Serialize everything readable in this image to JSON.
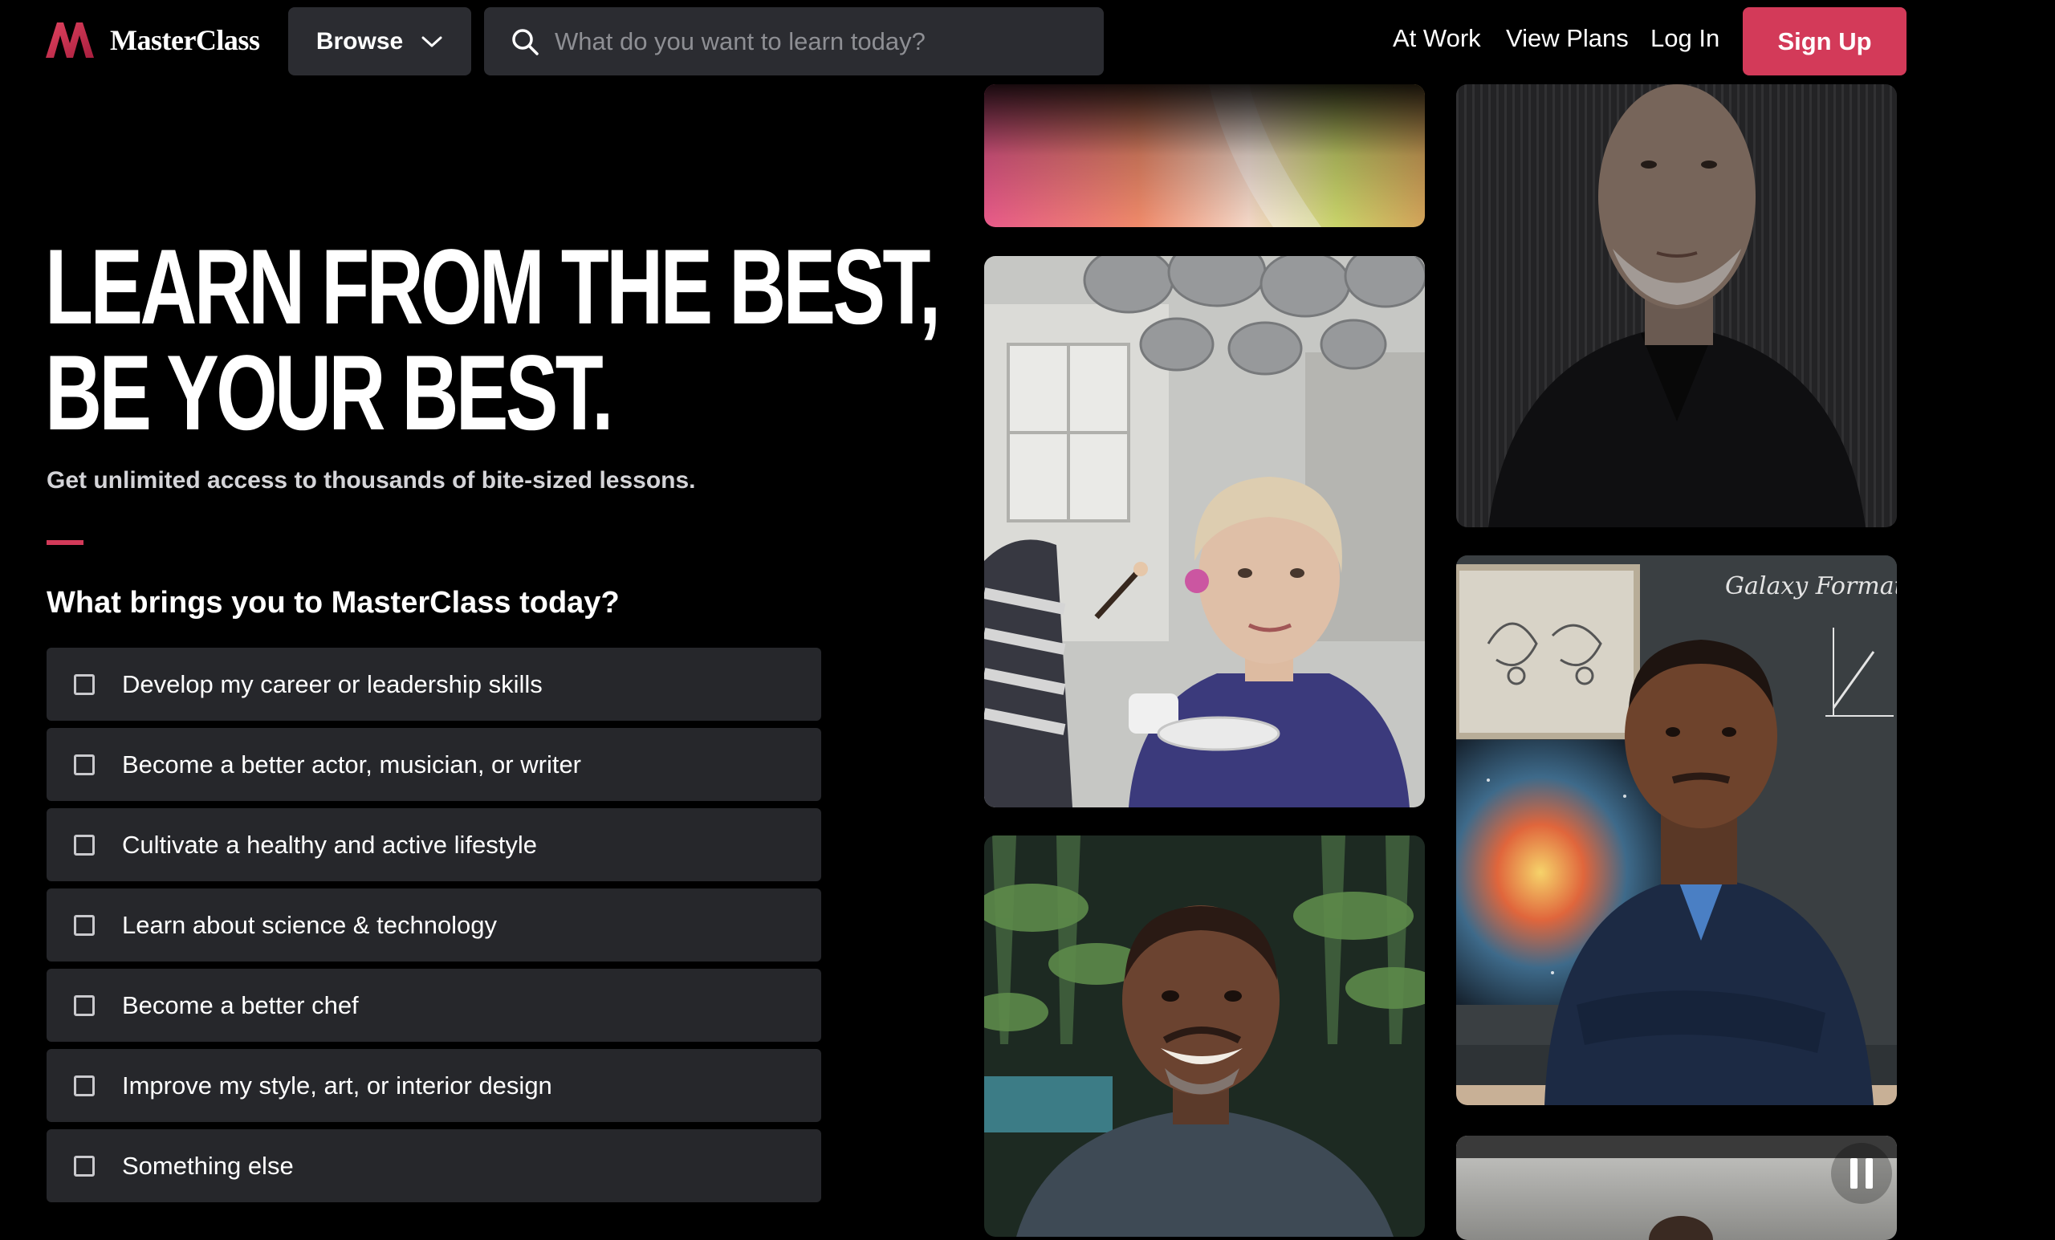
{
  "brand": {
    "name": "MasterClass",
    "accent": "#d33a59"
  },
  "header": {
    "browse_label": "Browse",
    "search_placeholder": "What do you want to learn today?",
    "links": {
      "at_work": "At Work",
      "view_plans": "View Plans",
      "log_in": "Log In"
    },
    "signup_label": "Sign Up"
  },
  "hero": {
    "headline_line1": "LEARN FROM THE BEST,",
    "headline_line2": "BE YOUR BEST.",
    "subheadline": "Get unlimited access to thousands of bite-sized lessons.",
    "question": "What brings you to MasterClass today?",
    "options": [
      {
        "label": "Develop my career or leadership skills",
        "checked": false
      },
      {
        "label": "Become a better actor, musician, or writer",
        "checked": false
      },
      {
        "label": "Cultivate a healthy and active lifestyle",
        "checked": false
      },
      {
        "label": "Learn about science & technology",
        "checked": false
      },
      {
        "label": "Become a better chef",
        "checked": false
      },
      {
        "label": "Improve my style, art, or interior design",
        "checked": false
      },
      {
        "label": "Something else",
        "checked": false
      }
    ]
  },
  "collage": {
    "tiles": [
      {
        "name": "gradient-artwork"
      },
      {
        "name": "kitchen-instructor-photo"
      },
      {
        "name": "smiling-instructor-photo"
      },
      {
        "name": "instructor-portrait-dark"
      },
      {
        "name": "science-instructor-photo",
        "chalkboard_text": "Galaxy Formation"
      },
      {
        "name": "partial-video-tile"
      }
    ],
    "pause_icon": "pause-icon"
  },
  "icons": {
    "search": "search-icon",
    "chevron": "chevron-down-icon",
    "checkbox": "checkbox-icon"
  }
}
